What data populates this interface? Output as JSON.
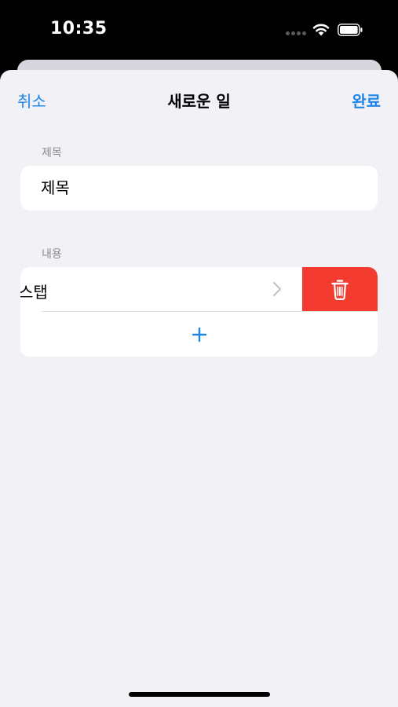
{
  "status_bar": {
    "time": "10:35",
    "icons": [
      "cellular-signal-icon",
      "wifi-icon",
      "battery-icon"
    ]
  },
  "nav": {
    "cancel_label": "취소",
    "title": "새로운 일",
    "done_label": "완료"
  },
  "title_section": {
    "header": "제목",
    "input_value": "",
    "input_placeholder": "제목"
  },
  "content_section": {
    "header": "내용",
    "steps": [
      {
        "label": "스탭",
        "swiped_open": true
      }
    ],
    "row_icons": [
      "chevron-right-icon",
      "trash-icon",
      "plus-icon"
    ]
  },
  "colors": {
    "accent": "#1f86e8",
    "destructive": "#f43b30",
    "background": "#f1f1f6",
    "card": "#ffffff",
    "secondary_text": "#8a8a8e"
  }
}
